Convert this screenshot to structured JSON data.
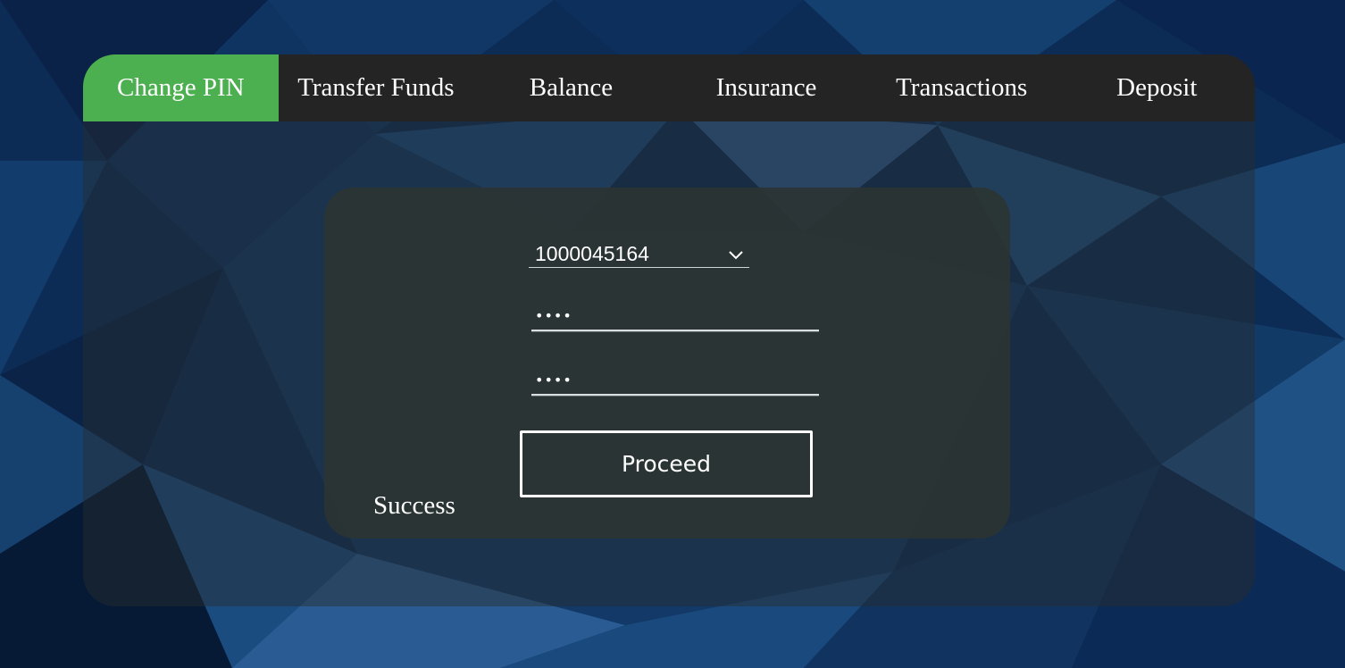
{
  "tabs": [
    {
      "label": "Change PIN",
      "active": true
    },
    {
      "label": "Transfer Funds",
      "active": false
    },
    {
      "label": "Balance",
      "active": false
    },
    {
      "label": "Insurance",
      "active": false
    },
    {
      "label": "Transactions",
      "active": false
    },
    {
      "label": "Deposit",
      "active": false
    }
  ],
  "form": {
    "account_select": {
      "value": "1000045164",
      "icon": "chevron-down-icon"
    },
    "current_pin": {
      "value": "••••"
    },
    "new_pin": {
      "value": "••••"
    },
    "proceed_label": "Proceed",
    "status_text": "Success"
  },
  "colors": {
    "active_tab": "#4caf50",
    "tab_bar": "#242424",
    "card": "#2b3433",
    "text": "#ffffff"
  }
}
